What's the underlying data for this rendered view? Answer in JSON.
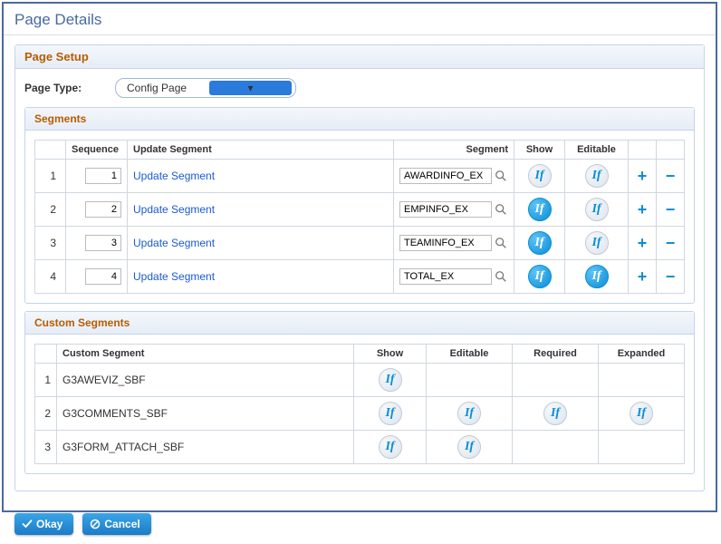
{
  "page_title": "Page Details",
  "setup": {
    "heading": "Page Setup",
    "page_type_label": "Page Type:",
    "page_type_value": "Config Page"
  },
  "segments": {
    "heading": "Segments",
    "columns": {
      "sequence": "Sequence",
      "update": "Update Segment",
      "segment": "Segment",
      "show": "Show",
      "editable": "Editable"
    },
    "update_link_text": "Update Segment",
    "rows": [
      {
        "idx": "1",
        "seq": "1",
        "segment": "AWARDINFO_EX",
        "show": "inactive",
        "editable": "inactive"
      },
      {
        "idx": "2",
        "seq": "2",
        "segment": "EMPINFO_EX",
        "show": "active",
        "editable": "inactive"
      },
      {
        "idx": "3",
        "seq": "3",
        "segment": "TEAMINFO_EX",
        "show": "active",
        "editable": "inactive"
      },
      {
        "idx": "4",
        "seq": "4",
        "segment": "TOTAL_EX",
        "show": "active",
        "editable": "active"
      }
    ]
  },
  "custom": {
    "heading": "Custom Segments",
    "columns": {
      "segment": "Custom Segment",
      "show": "Show",
      "editable": "Editable",
      "required": "Required",
      "expanded": "Expanded"
    },
    "rows": [
      {
        "idx": "1",
        "name": "G3AWEVIZ_SBF",
        "show": "inactive",
        "editable": "",
        "required": "",
        "expanded": ""
      },
      {
        "idx": "2",
        "name": "G3COMMENTS_SBF",
        "show": "inactive",
        "editable": "inactive",
        "required": "inactive",
        "expanded": "inactive"
      },
      {
        "idx": "3",
        "name": "G3FORM_ATTACH_SBF",
        "show": "inactive",
        "editable": "inactive",
        "required": "",
        "expanded": ""
      }
    ]
  },
  "buttons": {
    "ok": "Okay",
    "cancel": "Cancel"
  }
}
